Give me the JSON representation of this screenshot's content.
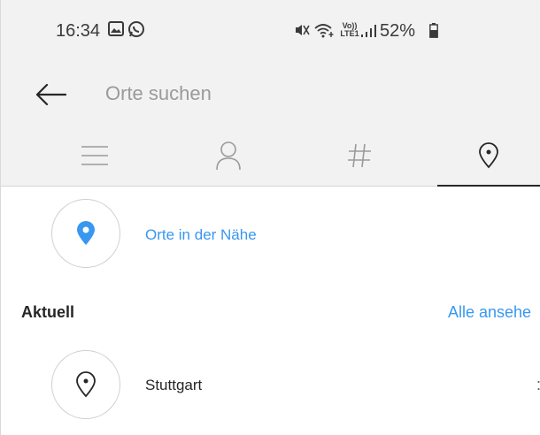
{
  "status_bar": {
    "time": "16:34",
    "network_label": "Vo)) LTE1",
    "battery": "52%",
    "icons": [
      "gallery-icon",
      "whatsapp-icon",
      "mute-icon",
      "wifi-icon",
      "signal-icon",
      "battery-icon"
    ]
  },
  "search": {
    "placeholder": "Orte suchen",
    "value": ""
  },
  "tabs": [
    {
      "icon": "menu-icon",
      "selected": false
    },
    {
      "icon": "user-icon",
      "selected": false
    },
    {
      "icon": "hashtag-icon",
      "selected": false
    },
    {
      "icon": "location-pin-icon",
      "selected": true
    }
  ],
  "nearby": {
    "label": "Orte in der Nähe"
  },
  "recent": {
    "title": "Aktuell",
    "see_all_label": "Alle ansehe",
    "items": [
      {
        "name": "Stuttgart",
        "icon": "location-pin-icon"
      }
    ]
  },
  "colors": {
    "accent": "#3897f0",
    "header_bg": "#f2f2f2",
    "text": "#262626"
  }
}
